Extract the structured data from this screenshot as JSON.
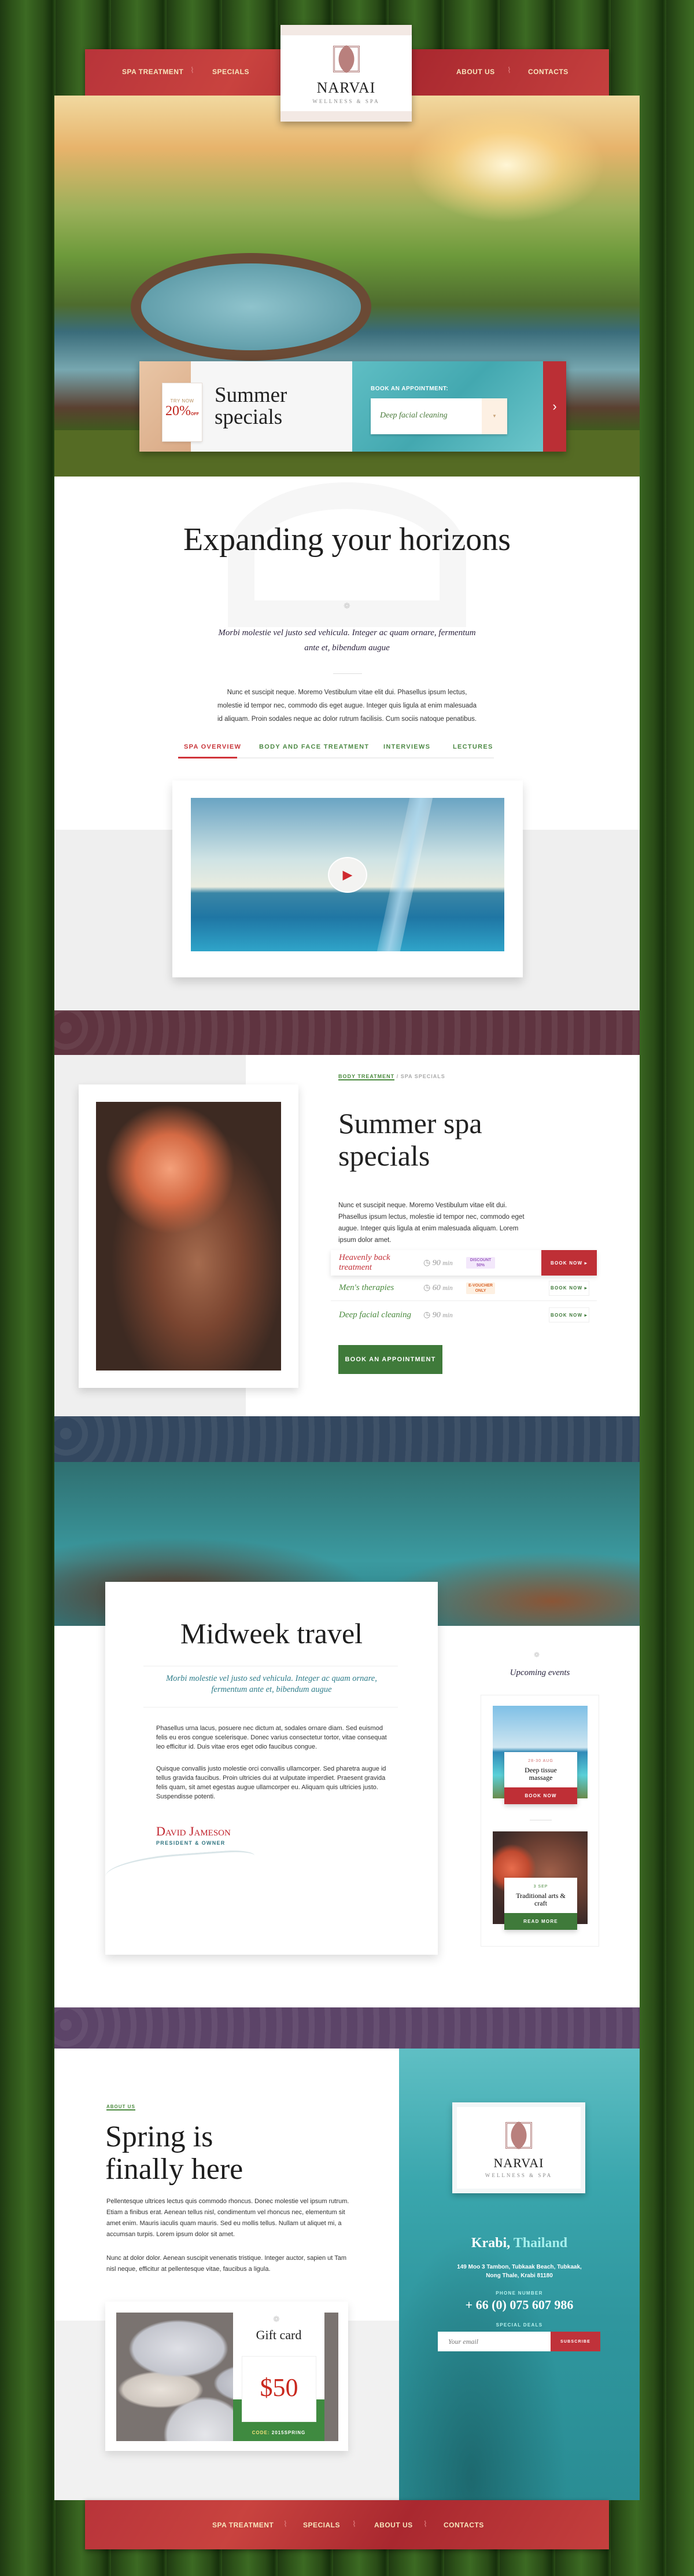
{
  "nav": {
    "items": [
      "SPA TREATMENT",
      "SPECIALS",
      "ABOUT US",
      "CONTACTS"
    ]
  },
  "logo": {
    "name": "NARVAI",
    "tagline": "WELLNESS & SPA"
  },
  "colors": {
    "red": "#b8343a",
    "green": "#3f7a3a",
    "teal": "#3aa7ad",
    "maroon": "#5f3440",
    "purple": "#5c4468"
  },
  "booking": {
    "promo_top": "TRY NOW",
    "promo_value": "20%",
    "promo_suffix": "OFF",
    "title": "Summer specials",
    "label": "BOOK AN APPOINTMENT:",
    "selected": "Deep facial cleaning",
    "next_icon": "chevron-right-icon"
  },
  "intro": {
    "title": "Expanding your horizons",
    "subtitle": "Morbi molestie vel justo sed vehicula. Integer ac quam ornare, fermentum ante et, bibendum augue",
    "body": "Nunc et suscipit neque. Moremo Vestibulum vitae elit dui. Phasellus ipsum lectus, molestie id tempor nec, commodo dis eget augue. Integer quis ligula at enim malesuada id aliquam. Proin sodales neque ac dolor rutrum facilisis. Cum sociis natoque penatibus.",
    "tabs": [
      {
        "label": "SPA OVERVIEW",
        "active": true
      },
      {
        "label": "BODY AND FACE TREATMENT",
        "active": false
      },
      {
        "label": "INTERVIEWS",
        "active": false
      },
      {
        "label": "LECTURES",
        "active": false
      }
    ]
  },
  "specials": {
    "breadcrumb": [
      "BODY TREATMENT",
      "SPA SPECIALS"
    ],
    "title": "Summer spa specials",
    "body": "Nunc et suscipit neque. Moremo Vestibulum vitae elit dui. Phasellus ipsum lectus, molestie id tempor nec, commodo eget augue. Integer quis ligula at enim malesuada aliquam. Lorem ipsum dolor amet.",
    "rows": [
      {
        "name": "Heavenly back treatment",
        "duration": "90",
        "unit": "min",
        "badge": "DISCOUNT 50%",
        "button": "BOOK NOW ▸"
      },
      {
        "name": "Men's therapies",
        "duration": "60",
        "unit": "min",
        "badge": "E-VOUCHER ONLY",
        "button": "BOOK NOW ▸"
      },
      {
        "name": "Deep facial cleaning",
        "duration": "90",
        "unit": "min",
        "badge": "",
        "button": "BOOK NOW ▸"
      }
    ],
    "cta": "BOOK AN APPOINTMENT"
  },
  "midweek": {
    "title": "Midweek travel",
    "quote": "Morbi molestie vel justo sed vehicula. Integer ac quam ornare, fermentum ante et, bibendum augue",
    "p1": "Phasellus urna lacus, posuere nec dictum at, sodales ornare diam. Sed euismod felis eu eros congue scelerisque. Donec varius consectetur tortor, vitae consequat leo efficitur id. Duis vitae eros eget odio faucibus congue.",
    "p2": "Quisque convallis justo molestie orci convallis ullamcorper. Sed pharetra augue id tellus gravida faucibus. Proin ultricies dui at vulputate imperdiet. Praesent gravida felis quam, sit amet egestas augue ullamcorper eu. Aliquam quis ultricies justo. Suspendisse potenti.",
    "author": "David Jameson",
    "role": "PRESIDENT & OWNER"
  },
  "events": {
    "title": "Upcoming events",
    "items": [
      {
        "date": "28-30 AUG",
        "name": "Deep tissue massage",
        "button": "BOOK NOW"
      },
      {
        "date": "3 SEP",
        "name": "Traditional arts & craft",
        "button": "READ MORE"
      }
    ]
  },
  "about": {
    "label": "ABOUT US",
    "title": "Spring is finally here",
    "p1": "Pellentesque ultrices lectus quis commodo rhoncus. Donec molestie vel ipsum rutrum. Etiam a finibus erat. Aenean tellus nisl, condimentum vel rhoncus nec, elementum sit amet enim. Mauris iaculis quam mauris. Sed eu mollis tellus. Nullam ut aliquet mi, a accumsan turpis. Lorem ipsum dolor sit amet.",
    "p2": "Nunc at dolor dolor. Aenean suscipit venenatis tristique. Integer auctor, sapien ut Tam nisl neque, efficitur at pellentesque vitae, faucibus a ligula.",
    "gift": {
      "title": "Gift card",
      "value": "$50",
      "code_label": "CODE:",
      "code": "2015SPRING"
    }
  },
  "contact": {
    "city": "Krabi,",
    "country": "Thailand",
    "address": "149 Moo 3 Tambon, Tubkaak Beach, Tubkaak, Nong Thale, Krabi 81180",
    "phone_label": "PHONE NUMBER",
    "phone": "+ 66 (0) 075 607 986",
    "deals_label": "SPECIAL DEALS",
    "email_placeholder": "Your email",
    "subscribe": "SUBSCRIBE"
  },
  "footer": {
    "items": [
      "SPA TREATMENT",
      "SPECIALS",
      "ABOUT US",
      "CONTACTS"
    ]
  }
}
